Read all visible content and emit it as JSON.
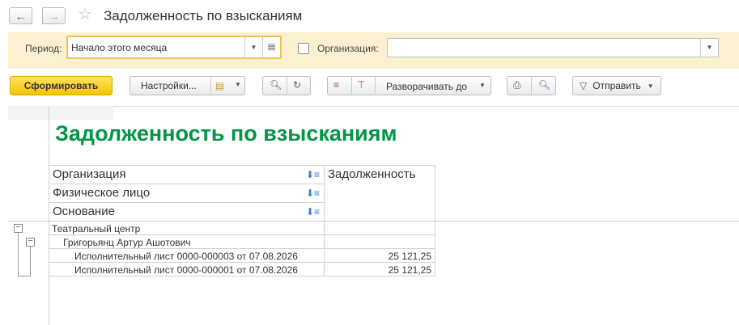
{
  "window": {
    "title": "Задолженность по взысканиям",
    "back_icon": "arrow-left-icon",
    "forward_icon": "arrow-right-icon",
    "favorite_icon": "star-icon"
  },
  "filters": {
    "period_label": "Период:",
    "period_value": "Начало этого месяца",
    "org_label": "Организация:",
    "org_value": ""
  },
  "toolbar": {
    "generate": "Сформировать",
    "settings": "Настройки...",
    "expand_to": "Разворачивать до",
    "send": "Отправить"
  },
  "report": {
    "title": "Задолженность по взысканиям",
    "headers": {
      "organization": "Организация",
      "person": "Физическое лицо",
      "basis": "Основание",
      "debt": "Задолженность"
    },
    "rows": [
      {
        "label": "Театральный центр",
        "value": ""
      },
      {
        "label": "Григорьянц Артур Ашотович",
        "value": ""
      },
      {
        "label": "Исполнительный лист 0000-000003 от 07.08.2026",
        "value": "25 121,25"
      },
      {
        "label": "Исполнительный лист 0000-000001 от 07.08.2026",
        "value": "25 121,25"
      }
    ]
  },
  "colors": {
    "accent_yellow": "#f5c400",
    "filter_bg": "#fbf0cf",
    "report_title": "#009646"
  }
}
